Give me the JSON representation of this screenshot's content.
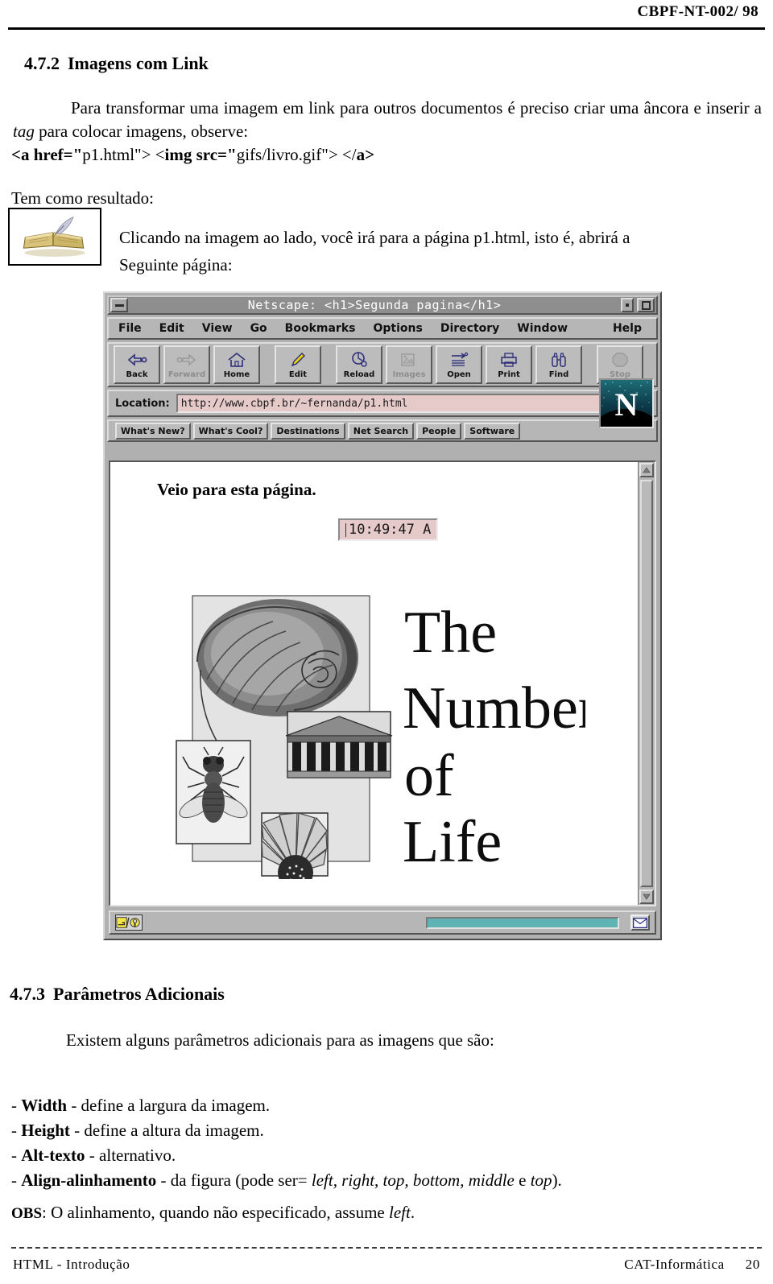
{
  "document": {
    "header_ref": "CBPF-NT-002/ 98",
    "footer_left": "HTML - Introdução",
    "footer_right": "CAT-Informática",
    "page_number": "20"
  },
  "section_472": {
    "number": "4.7.2",
    "title": "Imagens com Link",
    "intro": "Para transformar uma imagem em link para outros documentos é preciso criar uma âncora e inserir a tag para colocar imagens, observe:",
    "code_parts": {
      "p1": "<a href=\"",
      "p2": "p1.html\"> <",
      "p3": "img src=\"",
      "p4": "gifs/livro.gif\"> </",
      "p5": "a>"
    },
    "result_label": "Tem como resultado:",
    "click_line1": "Clicando na imagem ao lado, você irá para a página  p1.html,  isto   é,   abrirá   a",
    "click_line2": "Seguinte página:",
    "book_image_alt": "livro.gif"
  },
  "browser": {
    "window_title": "Netscape: <h1>Segunda pagina</h1>",
    "menu": [
      "File",
      "Edit",
      "View",
      "Go",
      "Bookmarks",
      "Options",
      "Directory",
      "Window"
    ],
    "menu_help": "Help",
    "toolbar": [
      {
        "label": "Back",
        "icon": "back-arrow-icon",
        "disabled": false
      },
      {
        "label": "Forward",
        "icon": "forward-arrow-icon",
        "disabled": true
      },
      {
        "label": "Home",
        "icon": "house-icon",
        "disabled": false
      },
      {
        "label": "Edit",
        "icon": "pencil-icon",
        "disabled": false
      },
      {
        "label": "Reload",
        "icon": "reload-icon",
        "disabled": false
      },
      {
        "label": "Images",
        "icon": "images-icon",
        "disabled": true
      },
      {
        "label": "Open",
        "icon": "open-icon",
        "disabled": false
      },
      {
        "label": "Print",
        "icon": "printer-icon",
        "disabled": false
      },
      {
        "label": "Find",
        "icon": "binoculars-icon",
        "disabled": false
      },
      {
        "label": "Stop",
        "icon": "stop-octagon-icon",
        "disabled": true
      }
    ],
    "location_label": "Location:",
    "location_value": "http://www.cbpf.br/~fernanda/p1.html",
    "directory_buttons": [
      "What's New?",
      "What's Cool?",
      "Destinations",
      "Net Search",
      "People",
      "Software"
    ],
    "logo_letter": "N",
    "page": {
      "heading": "Veio para esta página.",
      "clock_value": "10:49:47 A",
      "image_title_lines": [
        "The",
        "Numbers",
        "of",
        "Life"
      ],
      "image_alt": "The Numbers of Life"
    },
    "status": {
      "security_icon": "broken-key-icon",
      "message": "",
      "mail_icon": "envelope-icon"
    },
    "colors": {
      "chrome": "#b6b6b6",
      "titlebar": "#8e8e8e",
      "field": "#e6c9c9",
      "progress": "#5fb3b3"
    }
  },
  "section_473": {
    "number": "4.7.3",
    "title": "Parâmetros Adicionais",
    "intro": "Existem alguns parâmetros adicionais para as imagens que são:",
    "params": [
      {
        "dash": "- ",
        "name": "Width",
        "desc": " - define a largura da imagem."
      },
      {
        "dash": "- ",
        "name": "Height",
        "desc": " - define a altura da imagem."
      },
      {
        "dash": "- ",
        "name": "Alt-texto",
        "desc": " - alternativo."
      },
      {
        "dash": "- ",
        "name": "Align-alinhamento",
        "desc": " - da figura (pode ser= "
      }
    ],
    "align_values": "left, right, top, bottom, middle",
    "align_tail_e": " e ",
    "align_last": "top",
    "align_close": ").",
    "obs_label": "OBS",
    "obs_text": ": O alinhamento, quando não especificado, assume ",
    "obs_italic": "left",
    "obs_period": "."
  }
}
